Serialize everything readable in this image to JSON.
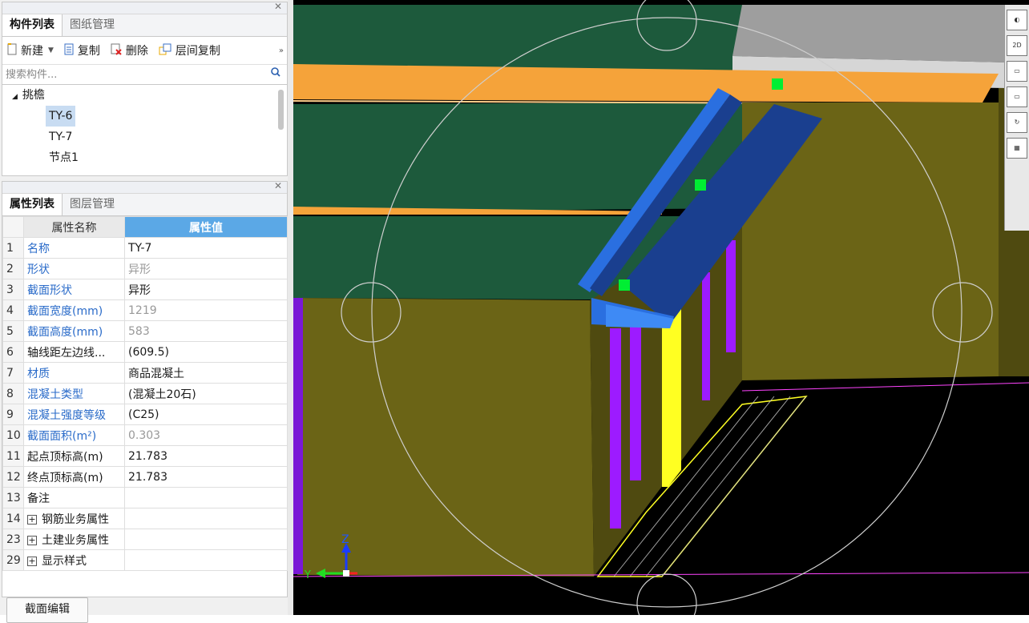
{
  "component_panel": {
    "tabs": [
      "构件列表",
      "图纸管理"
    ],
    "toolbar": {
      "new_label": "新建",
      "copy_label": "复制",
      "delete_label": "删除",
      "floor_copy_label": "层间复制"
    },
    "search_placeholder": "搜索构件...",
    "tree": {
      "root": "挑檐",
      "children": [
        "TY-6",
        "TY-7",
        "节点1"
      ],
      "selected": "TY-6"
    }
  },
  "property_panel": {
    "tabs": [
      "属性列表",
      "图层管理"
    ],
    "header": {
      "name": "属性名称",
      "value": "属性值"
    },
    "rows": [
      {
        "num": "1",
        "name": "名称",
        "value": "TY-7"
      },
      {
        "num": "2",
        "name": "形状",
        "value": "异形"
      },
      {
        "num": "3",
        "name": "截面形状",
        "value": "异形"
      },
      {
        "num": "4",
        "name": "截面宽度(mm)",
        "value": "1219"
      },
      {
        "num": "5",
        "name": "截面高度(mm)",
        "value": "583"
      },
      {
        "num": "6",
        "name": "轴线距左边线...",
        "value": "(609.5)"
      },
      {
        "num": "7",
        "name": "材质",
        "value": "商品混凝土"
      },
      {
        "num": "8",
        "name": "混凝土类型",
        "value": "(混凝土20石)"
      },
      {
        "num": "9",
        "name": "混凝土强度等级",
        "value": "(C25)"
      },
      {
        "num": "10",
        "name": "截面面积(m²)",
        "value": "0.303"
      },
      {
        "num": "11",
        "name": "起点顶标高(m)",
        "value": "21.783"
      },
      {
        "num": "12",
        "name": "终点顶标高(m)",
        "value": "21.783"
      },
      {
        "num": "13",
        "name": "备注",
        "value": ""
      },
      {
        "num": "14",
        "name": "钢筋业务属性",
        "value": ""
      },
      {
        "num": "23",
        "name": "土建业务属性",
        "value": ""
      },
      {
        "num": "29",
        "name": "显示样式",
        "value": ""
      }
    ],
    "section_edit_button": "截面编辑"
  },
  "viewport": {
    "axis_z": "Z",
    "axis_y": "Y",
    "view_2d_label": "2D",
    "colors": {
      "beam": "#1a3f8f",
      "wall": "#6b6416",
      "slab": "#1d5a3c",
      "band": "#f5a33a"
    }
  }
}
